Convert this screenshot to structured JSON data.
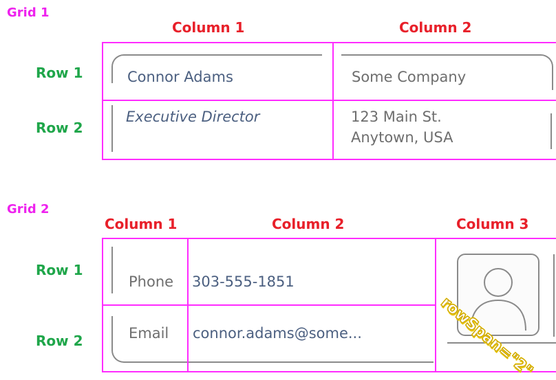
{
  "grid1": {
    "title": "Grid 1",
    "columns": [
      "Column 1",
      "Column 2"
    ],
    "rows": [
      "Row 1",
      "Row 2"
    ],
    "cells": {
      "name": "Connor Adams",
      "company": "Some Company",
      "role": "Executive Director",
      "address_line1": "123 Main St.",
      "address_line2": "Anytown, USA"
    }
  },
  "grid2": {
    "title": "Grid 2",
    "columns": [
      "Column 1",
      "Column 2",
      "Column 3"
    ],
    "rows": [
      "Row 1",
      "Row 2"
    ],
    "cells": {
      "phone_label": "Phone",
      "phone_value": "303-555-1851",
      "email_label": "Email",
      "email_value": "connor.adams@some..."
    },
    "rowspan_note": "rowSpan=\"2\"",
    "avatar_icon": "person-silhouette-icon"
  },
  "colors": {
    "grid_lines": "#ff2bff",
    "grid_title": "#ee22ee",
    "column_label": "#e8202a",
    "row_label": "#1fa64a",
    "rowspan_tag": "#e7c400"
  }
}
